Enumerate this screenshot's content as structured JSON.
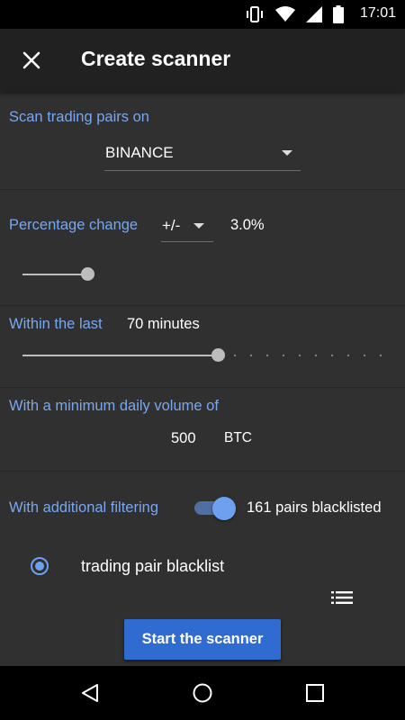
{
  "status_bar": {
    "time": "17:01",
    "icons": [
      "vibrate-icon",
      "wifi-icon",
      "signal-icon",
      "battery-icon"
    ]
  },
  "app_bar": {
    "title": "Create scanner",
    "close_icon": "close-icon"
  },
  "exchange": {
    "label": "Scan trading pairs on",
    "value": "BINANCE"
  },
  "percentage": {
    "label": "Percentage change",
    "direction": "+/-",
    "value": "3.0%",
    "slider_fraction": 0.28
  },
  "timeframe": {
    "label": "Within the last",
    "value": "70 minutes",
    "slider_fraction": 0.54
  },
  "volume": {
    "label": "With a minimum daily volume of",
    "amount": "500",
    "unit": "BTC"
  },
  "filtering": {
    "label": "With additional filtering",
    "enabled": true,
    "summary": "161 pairs blacklisted"
  },
  "filter_option": {
    "label": "trading pair blacklist",
    "selected": true
  },
  "start_button": {
    "label": "Start the scanner"
  },
  "nav_bar": {
    "buttons": [
      "back-icon",
      "home-icon",
      "recents-icon"
    ]
  },
  "colors": {
    "accent": "#79a7ef",
    "button": "#2f6bd0",
    "background": "#303030",
    "app_bar": "#212121"
  }
}
